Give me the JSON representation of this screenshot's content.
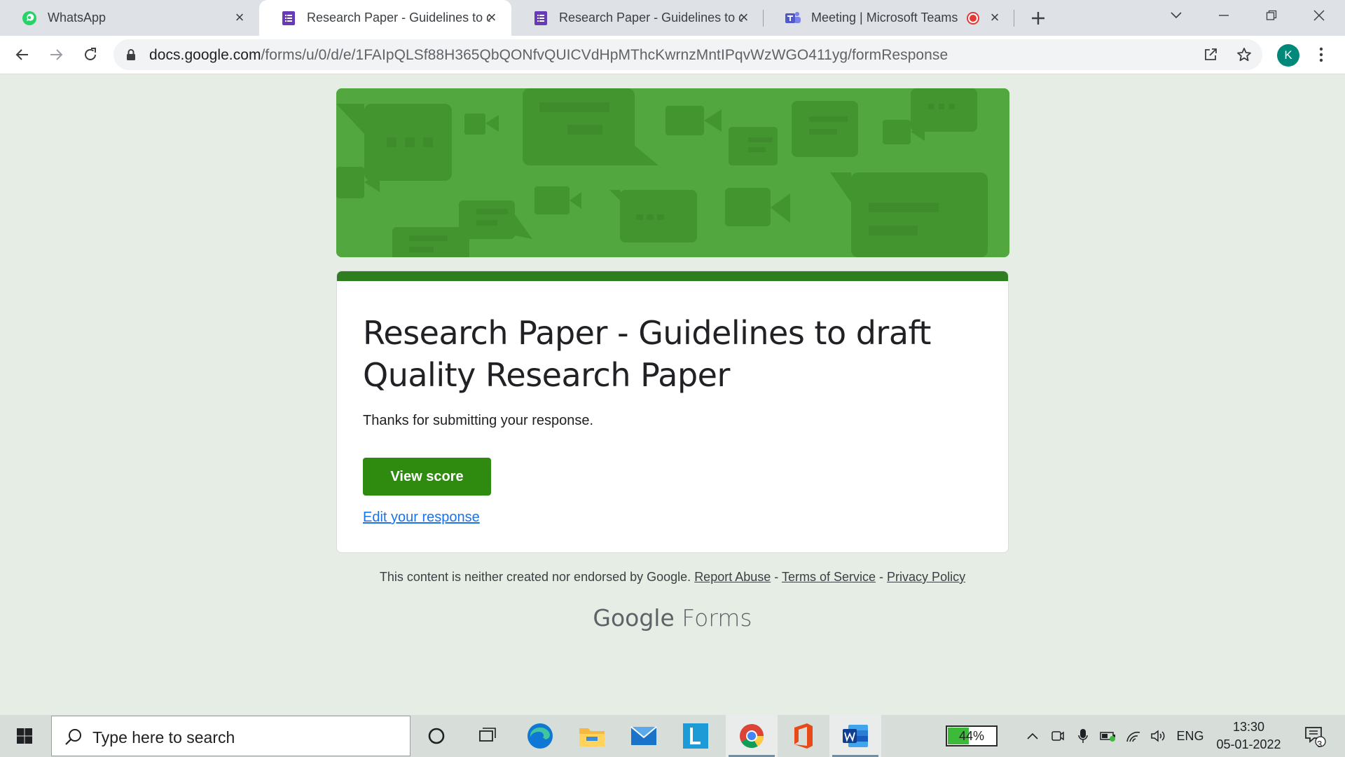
{
  "browser": {
    "tabs": [
      {
        "title": "WhatsApp",
        "icon": "whatsapp-icon"
      },
      {
        "title": "Research Paper - Guidelines to draft",
        "icon": "google-forms-icon"
      },
      {
        "title": "Research Paper - Guidelines to draft",
        "icon": "google-forms-icon"
      },
      {
        "title": "Meeting | Microsoft Teams",
        "icon": "teams-icon"
      }
    ],
    "url_host": "docs.google.com",
    "url_path": "/forms/u/0/d/e/1FAIpQLSf88H365QbQONfvQUICVdHpMThcKwrnzMntIPqvWzWGO411yg/formResponse",
    "profile_initial": "K"
  },
  "form": {
    "title": "Research Paper - Guidelines to draft Quality Research Paper",
    "confirmation": "Thanks for submitting your response.",
    "view_score_label": "View score",
    "edit_response_label": "Edit your response",
    "accent_color": "#2e7d1f",
    "header_color": "#52a83f"
  },
  "footer": {
    "disclaimer": "This content is neither created nor endorsed by Google.",
    "report_abuse": "Report Abuse",
    "sep": "-",
    "terms": "Terms of Service",
    "privacy": "Privacy Policy",
    "brand_google": "Google",
    "brand_forms": "Forms"
  },
  "taskbar": {
    "search_placeholder": "Type here to search",
    "battery_level": 0.44,
    "battery_label": "44%",
    "language": "ENG",
    "time": "13:30",
    "date": "05-01-2022",
    "notification_count": "3"
  }
}
